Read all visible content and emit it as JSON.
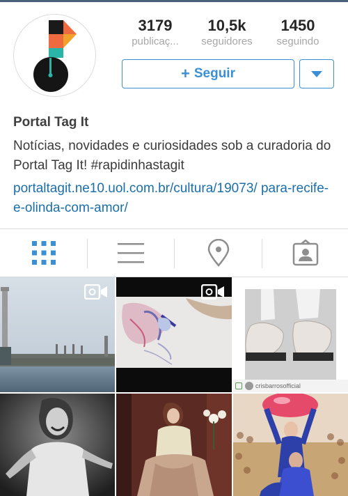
{
  "profile": {
    "stats": [
      {
        "value": "3179",
        "label": "publicaç..."
      },
      {
        "value": "10,5k",
        "label": "seguidores"
      },
      {
        "value": "1450",
        "label": "seguindo"
      }
    ],
    "follow_label": "Seguir",
    "follow_plus": "+",
    "name": "Portal Tag It",
    "bio": "Notícias, novidades e curiosidades sob a curadoria do Portal Tag It! #rapidinhastagit",
    "link": "portaltagit.ne10.uol.com.br/cultura/19073/ para-recife-e-olinda-com-amor/"
  },
  "tabs": [
    {
      "icon": "grid-icon"
    },
    {
      "icon": "list-icon"
    },
    {
      "icon": "location-pin-icon"
    },
    {
      "icon": "tagged-person-icon"
    }
  ],
  "posts": [
    {
      "type": "video",
      "icon": "video-camera-icon"
    },
    {
      "type": "video",
      "icon": "video-camera-icon"
    },
    {
      "type": "photo",
      "credit": "crisbarrosofficial"
    },
    {
      "type": "photo"
    },
    {
      "type": "photo"
    },
    {
      "type": "photo"
    }
  ],
  "colors": {
    "accent": "#3b8fd4",
    "link": "#1a6fab",
    "tab_active": "#3b8fd4",
    "tab_inactive": "#8e8e8e"
  }
}
